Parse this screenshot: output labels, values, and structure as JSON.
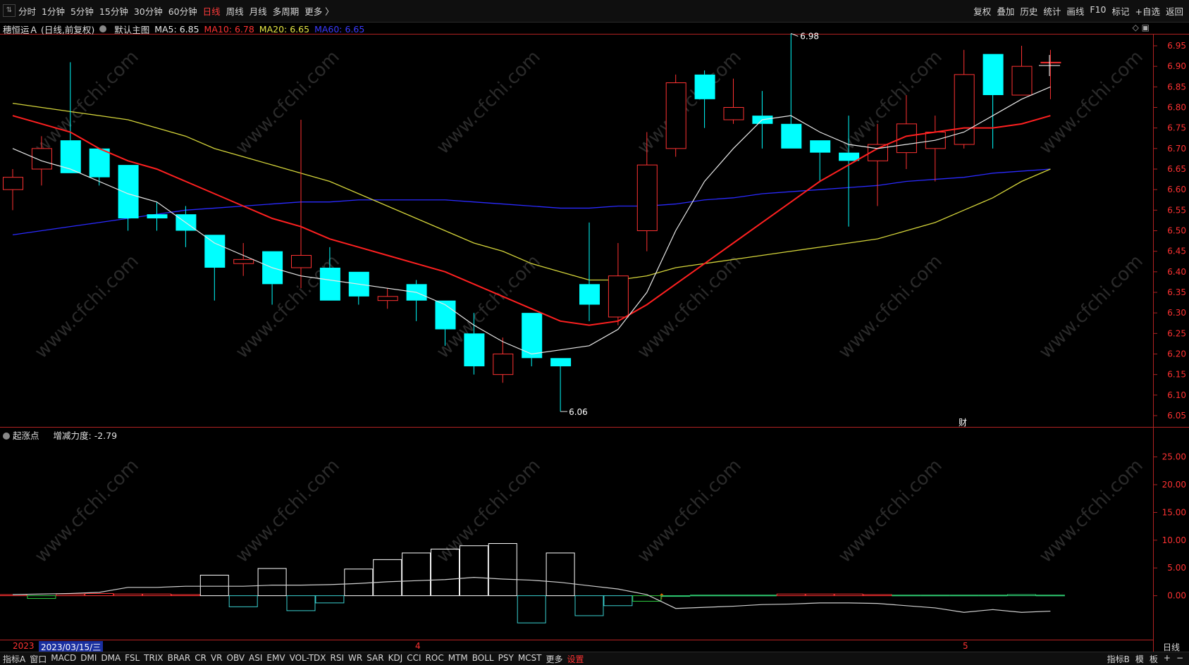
{
  "toolbar": {
    "back_icon": "arrows-icon",
    "periods": [
      "分时",
      "1分钟",
      "5分钟",
      "15分钟",
      "30分钟",
      "60分钟",
      "日线",
      "周线",
      "月线",
      "多周期",
      "更多 〉"
    ],
    "active_period": "日线",
    "right": [
      "复权",
      "叠加",
      "历史",
      "统计",
      "画线",
      "F10",
      "标记",
      "+自选",
      "返回"
    ]
  },
  "main_info": {
    "stock": "穗恒运Ａ (日线,前复权)",
    "main_label": "默认主图",
    "ma5": "MA5: 6.85",
    "ma10": "MA10: 6.78",
    "ma20": "MA20: 6.65",
    "ma60": "MA60: 6.65"
  },
  "colors": {
    "up": "#ff3232",
    "down": "#00ffff",
    "ma5": "#e8e8e8",
    "ma10": "#ff2020",
    "ma20": "#d4d43a",
    "ma60": "#2a2aff",
    "axis_border": "#b22222"
  },
  "price_axis": [
    "6.95",
    "6.90",
    "6.85",
    "6.80",
    "6.75",
    "6.70",
    "6.65",
    "6.60",
    "6.55",
    "6.50",
    "6.45",
    "6.40",
    "6.35",
    "6.30",
    "6.25",
    "6.20",
    "6.15",
    "6.10",
    "6.05"
  ],
  "annotations": {
    "high": "6.98",
    "low": "6.06",
    "event": "财"
  },
  "sub_info": {
    "indicator": "起涨点",
    "value": "增减力度: -2.79"
  },
  "sub_axis": [
    "25.00",
    "20.00",
    "15.00",
    "10.00",
    "5.00",
    "0.00"
  ],
  "dates": {
    "first": "2023/03/15/三",
    "prefix": "2023",
    "apr": "4",
    "may": "5"
  },
  "right_axis_label": "日线",
  "bottom": {
    "items": [
      "指标A",
      "窗口",
      "MACD",
      "DMI",
      "DMA",
      "FSL",
      "TRIX",
      "BRAR",
      "CR",
      "VR",
      "OBV",
      "ASI",
      "EMV",
      "VOL-TDX",
      "RSI",
      "WR",
      "SAR",
      "KDJ",
      "CCI",
      "ROC",
      "MTM",
      "BOLL",
      "PSY",
      "MCST",
      "更多",
      "设置"
    ],
    "right": [
      "指标B",
      "模",
      "板",
      "+",
      "−"
    ]
  },
  "watermark": "www.cfchi.com",
  "chart_data": {
    "type": "candlestick",
    "dates_label": "daily",
    "ylim": [
      6.05,
      6.95
    ],
    "candles": [
      {
        "o": 6.6,
        "c": 6.63,
        "h": 6.65,
        "l": 6.55
      },
      {
        "o": 6.65,
        "c": 6.7,
        "h": 6.73,
        "l": 6.61
      },
      {
        "o": 6.72,
        "c": 6.64,
        "h": 6.91,
        "l": 6.64
      },
      {
        "o": 6.7,
        "c": 6.63,
        "h": 6.7,
        "l": 6.61
      },
      {
        "o": 6.66,
        "c": 6.53,
        "h": 6.66,
        "l": 6.5
      },
      {
        "o": 6.54,
        "c": 6.53,
        "h": 6.57,
        "l": 6.5
      },
      {
        "o": 6.54,
        "c": 6.5,
        "h": 6.56,
        "l": 6.46
      },
      {
        "o": 6.49,
        "c": 6.41,
        "h": 6.49,
        "l": 6.33
      },
      {
        "o": 6.42,
        "c": 6.43,
        "h": 6.47,
        "l": 6.39
      },
      {
        "o": 6.45,
        "c": 6.37,
        "h": 6.45,
        "l": 6.32
      },
      {
        "o": 6.41,
        "c": 6.44,
        "h": 6.77,
        "l": 6.36
      },
      {
        "o": 6.41,
        "c": 6.33,
        "h": 6.46,
        "l": 6.33
      },
      {
        "o": 6.4,
        "c": 6.34,
        "h": 6.4,
        "l": 6.32
      },
      {
        "o": 6.33,
        "c": 6.34,
        "h": 6.36,
        "l": 6.31
      },
      {
        "o": 6.37,
        "c": 6.33,
        "h": 6.38,
        "l": 6.28
      },
      {
        "o": 6.33,
        "c": 6.26,
        "h": 6.33,
        "l": 6.22
      },
      {
        "o": 6.25,
        "c": 6.17,
        "h": 6.3,
        "l": 6.15
      },
      {
        "o": 6.15,
        "c": 6.2,
        "h": 6.24,
        "l": 6.13
      },
      {
        "o": 6.3,
        "c": 6.19,
        "h": 6.3,
        "l": 6.17
      },
      {
        "o": 6.19,
        "c": 6.17,
        "h": 6.19,
        "l": 6.06
      },
      {
        "o": 6.37,
        "c": 6.32,
        "h": 6.52,
        "l": 6.28
      },
      {
        "o": 6.29,
        "c": 6.39,
        "h": 6.47,
        "l": 6.27
      },
      {
        "o": 6.5,
        "c": 6.66,
        "h": 6.74,
        "l": 6.45
      },
      {
        "o": 6.7,
        "c": 6.86,
        "h": 6.88,
        "l": 6.68
      },
      {
        "o": 6.88,
        "c": 6.82,
        "h": 6.89,
        "l": 6.75
      },
      {
        "o": 6.77,
        "c": 6.8,
        "h": 6.87,
        "l": 6.76
      },
      {
        "o": 6.78,
        "c": 6.76,
        "h": 6.84,
        "l": 6.7
      },
      {
        "o": 6.76,
        "c": 6.7,
        "h": 6.98,
        "l": 6.7
      },
      {
        "o": 6.72,
        "c": 6.69,
        "h": 6.72,
        "l": 6.62
      },
      {
        "o": 6.69,
        "c": 6.67,
        "h": 6.78,
        "l": 6.51
      },
      {
        "o": 6.67,
        "c": 6.71,
        "h": 6.76,
        "l": 6.56
      },
      {
        "o": 6.69,
        "c": 6.76,
        "h": 6.83,
        "l": 6.65
      },
      {
        "o": 6.7,
        "c": 6.74,
        "h": 6.78,
        "l": 6.62
      },
      {
        "o": 6.71,
        "c": 6.88,
        "h": 6.94,
        "l": 6.7
      },
      {
        "o": 6.93,
        "c": 6.83,
        "h": 6.93,
        "l": 6.7
      },
      {
        "o": 6.83,
        "c": 6.9,
        "h": 6.95,
        "l": 6.83
      },
      {
        "o": 6.91,
        "c": 6.91,
        "h": 6.94,
        "l": 6.82
      }
    ],
    "ma5": [
      6.7,
      6.67,
      6.65,
      6.62,
      6.59,
      6.57,
      6.52,
      6.47,
      6.44,
      6.41,
      6.39,
      6.38,
      6.37,
      6.36,
      6.35,
      6.32,
      6.27,
      6.23,
      6.2,
      6.21,
      6.22,
      6.26,
      6.35,
      6.5,
      6.62,
      6.7,
      6.77,
      6.78,
      6.74,
      6.71,
      6.7,
      6.71,
      6.72,
      6.74,
      6.78,
      6.82,
      6.85
    ],
    "ma10": [
      6.78,
      6.76,
      6.74,
      6.7,
      6.67,
      6.65,
      6.62,
      6.59,
      6.56,
      6.53,
      6.51,
      6.48,
      6.46,
      6.44,
      6.42,
      6.4,
      6.37,
      6.34,
      6.31,
      6.28,
      6.27,
      6.28,
      6.32,
      6.37,
      6.42,
      6.47,
      6.52,
      6.57,
      6.62,
      6.66,
      6.7,
      6.73,
      6.74,
      6.75,
      6.75,
      6.76,
      6.78
    ],
    "ma20": [
      6.81,
      6.8,
      6.79,
      6.78,
      6.77,
      6.75,
      6.73,
      6.7,
      6.68,
      6.66,
      6.64,
      6.62,
      6.59,
      6.56,
      6.53,
      6.5,
      6.47,
      6.45,
      6.42,
      6.4,
      6.38,
      6.38,
      6.39,
      6.41,
      6.42,
      6.43,
      6.44,
      6.45,
      6.46,
      6.47,
      6.48,
      6.5,
      6.52,
      6.55,
      6.58,
      6.62,
      6.65
    ],
    "ma60": [
      6.49,
      6.5,
      6.51,
      6.52,
      6.53,
      6.54,
      6.55,
      6.555,
      6.56,
      6.565,
      6.57,
      6.57,
      6.575,
      6.575,
      6.575,
      6.575,
      6.57,
      6.565,
      6.56,
      6.555,
      6.555,
      6.56,
      6.56,
      6.565,
      6.575,
      6.58,
      6.59,
      6.595,
      6.6,
      6.605,
      6.61,
      6.62,
      6.625,
      6.63,
      6.64,
      6.645,
      6.65
    ],
    "sub": {
      "ylim": [
        -5,
        28
      ],
      "bars": [
        0.2,
        -0.5,
        0.3,
        0.4,
        0.3,
        0.3,
        0.2,
        3.7,
        -2.0,
        4.9,
        -2.7,
        -1.3,
        4.8,
        6.5,
        7.7,
        8.4,
        9.0,
        9.4,
        -4.9,
        7.7,
        -3.6,
        -1.8,
        -1.0,
        0.0,
        0.1,
        0.1,
        0.1,
        0.3,
        0.3,
        0.3,
        0.2,
        0.1,
        0.1,
        0.1,
        0.1,
        0.2,
        0.1
      ],
      "line": [
        0.2,
        0.3,
        0.4,
        0.6,
        1.5,
        1.5,
        1.7,
        1.7,
        1.7,
        1.9,
        1.9,
        2.0,
        2.2,
        2.5,
        2.7,
        2.9,
        3.3,
        3.0,
        2.8,
        2.4,
        1.8,
        1.2,
        0.2,
        -2.3,
        -2.1,
        -1.9,
        -1.6,
        -1.5,
        -1.3,
        -1.3,
        -1.4,
        -1.8,
        -2.2,
        -3.0,
        -2.5,
        -3.0,
        -2.79
      ]
    }
  }
}
